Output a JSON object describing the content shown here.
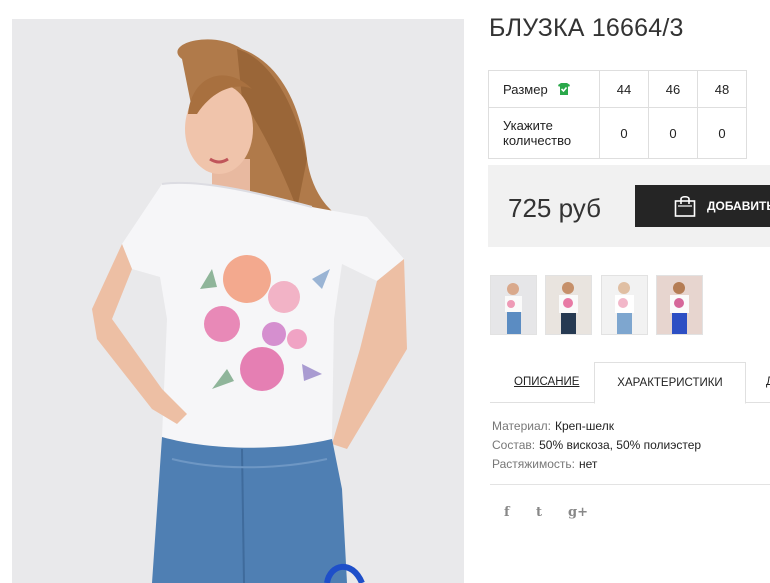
{
  "product": {
    "title": "БЛУЗКА 16664/3",
    "price": "725 руб",
    "add_button_label": "ДОБАВИТЬ"
  },
  "sizes": {
    "size_label": "Размер",
    "qty_label": "Укажите количество",
    "values": [
      "44",
      "46",
      "48"
    ],
    "quantities": [
      "0",
      "0",
      "0"
    ]
  },
  "tabs": {
    "description": "ОПИСАНИЕ",
    "characteristics": "ХАРАКТЕРИСТИКИ",
    "third": "Д"
  },
  "specs": [
    {
      "key": "Материал:",
      "value": "Креп-шелк"
    },
    {
      "key": "Состав:",
      "value": "50% вискоза, 50% полиэстер"
    },
    {
      "key": "Растяжимость:",
      "value": "нет"
    }
  ],
  "social": [
    "f",
    "t",
    "g+"
  ],
  "colors": {
    "button_bg": "#252525",
    "price_box_bg": "#f1f1f1",
    "check_green": "#2aa84a"
  }
}
